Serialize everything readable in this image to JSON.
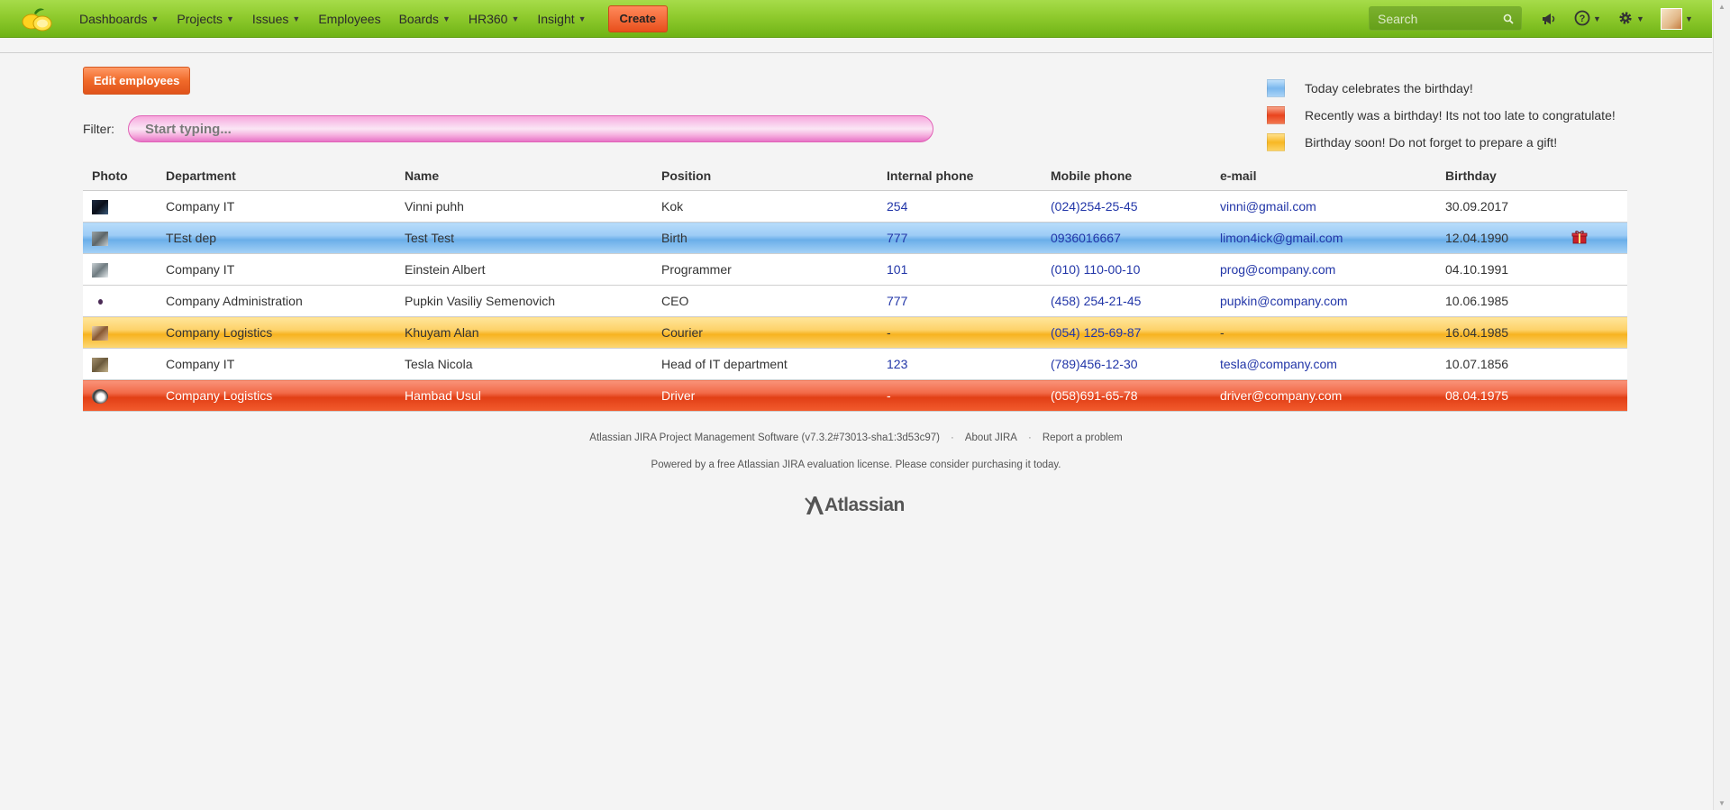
{
  "nav": {
    "items": [
      {
        "label": "Dashboards",
        "dropdown": true
      },
      {
        "label": "Projects",
        "dropdown": true
      },
      {
        "label": "Issues",
        "dropdown": true
      },
      {
        "label": "Employees",
        "dropdown": false
      },
      {
        "label": "Boards",
        "dropdown": true
      },
      {
        "label": "HR360",
        "dropdown": true
      },
      {
        "label": "Insight",
        "dropdown": true
      }
    ],
    "create_label": "Create",
    "search_placeholder": "Search"
  },
  "edit_button": "Edit employees",
  "filter": {
    "label": "Filter:",
    "placeholder": "Start typing..."
  },
  "legend": [
    {
      "style": "today",
      "text": "Today celebrates the birthday!"
    },
    {
      "style": "recent",
      "text": "Recently was a birthday! Its not too late to congratulate!"
    },
    {
      "style": "soon",
      "text": "Birthday soon! Do not forget to prepare a gift!"
    }
  ],
  "table": {
    "headers": [
      "Photo",
      "Department",
      "Name",
      "Position",
      "Internal phone",
      "Mobile phone",
      "e-mail",
      "Birthday"
    ],
    "rows": [
      {
        "style": "normal",
        "photo": "dark",
        "department": "Company IT",
        "name": "Vinni puhh",
        "position": "Kok",
        "internal": "254",
        "mobile": "(024)254-25-45",
        "email": "vinni@gmail.com",
        "birthday": "30.09.2017",
        "gift": false
      },
      {
        "style": "today",
        "photo": "grey",
        "department": "TEst dep",
        "name": "Test Test",
        "position": "Birth",
        "internal": "777",
        "mobile": "0936016667",
        "email": "limon4ick@gmail.com",
        "birthday": "12.04.1990",
        "gift": true
      },
      {
        "style": "normal",
        "photo": "bird",
        "department": "Company IT",
        "name": "Einstein Albert",
        "position": "Programmer",
        "internal": "101",
        "mobile": "(010) 110-00-10",
        "email": "prog@company.com",
        "birthday": "04.10.1991",
        "gift": false
      },
      {
        "style": "normal",
        "photo": "dot",
        "department": "Company Administration",
        "name": "Pupkin Vasiliy Semenovich",
        "position": "CEO",
        "internal": "777",
        "mobile": "(458) 254-21-45",
        "email": "pupkin@company.com",
        "birthday": "10.06.1985",
        "gift": false
      },
      {
        "style": "soon",
        "photo": "face",
        "department": "Company Logistics",
        "name": "Khuyam Alan",
        "position": "Courier",
        "internal": "-",
        "mobile": "(054) 125-69-87",
        "email": "-",
        "birthday": "16.04.1985",
        "gift": false
      },
      {
        "style": "normal",
        "photo": "cat",
        "department": "Company IT",
        "name": "Tesla Nicola",
        "position": "Head of IT department",
        "internal": "123",
        "mobile": "(789)456-12-30",
        "email": "tesla@company.com",
        "birthday": "10.07.1856",
        "gift": false
      },
      {
        "style": "recent",
        "photo": "penguin",
        "department": "Company Logistics",
        "name": "Hambad Usul",
        "position": "Driver",
        "internal": "-",
        "mobile": "(058)691-65-78",
        "email": "driver@company.com",
        "birthday": "08.04.1975",
        "gift": false
      }
    ]
  },
  "footer": {
    "software": "Atlassian JIRA Project Management Software (v7.3.2#73013-sha1:3d53c97)",
    "about": "About JIRA",
    "report": "Report a problem",
    "license": "Powered by a free Atlassian JIRA evaluation license. Please consider purchasing it today.",
    "brand": "Atlassian"
  },
  "icons": {
    "logo": "lemons-logo-icon",
    "search": "search-icon",
    "notifications": "megaphone-icon",
    "help": "help-icon",
    "settings": "gear-icon",
    "gift": "gift-icon"
  },
  "colors": {
    "topbar": "#8fca2d",
    "create": "#e84f1c",
    "today": "#7ab8ee",
    "recent": "#e9431d",
    "soon": "#f8b824",
    "link": "#2236a8"
  }
}
